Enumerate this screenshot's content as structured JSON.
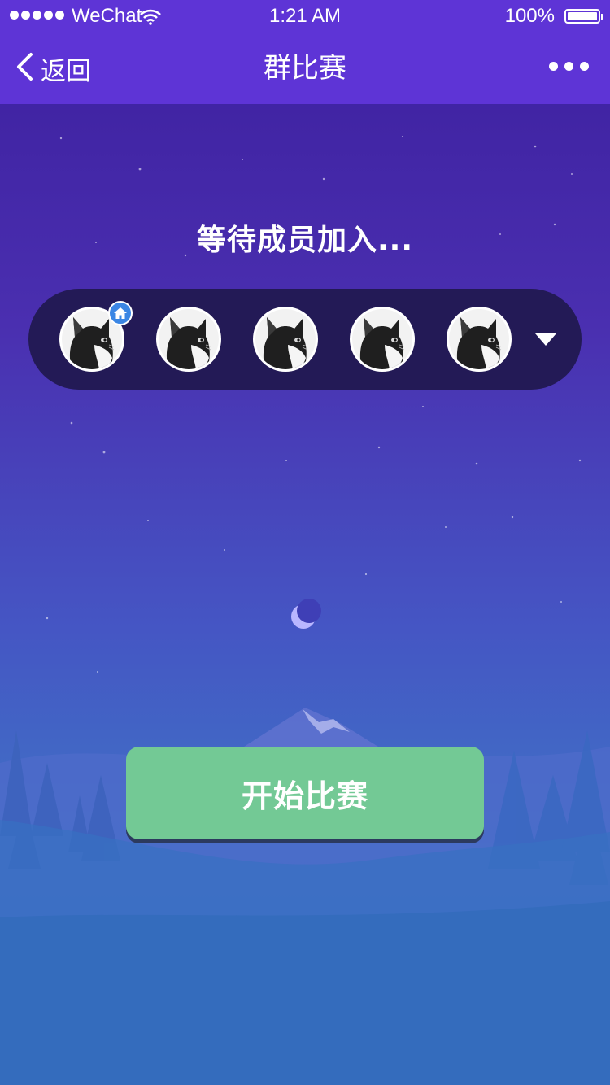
{
  "status_bar": {
    "carrier": "WeChat",
    "time": "1:21 AM",
    "battery": "100%"
  },
  "nav": {
    "back_label": "返回",
    "title": "群比赛"
  },
  "main": {
    "waiting_text": "等待成员加入...",
    "start_button": "开始比赛"
  },
  "members": [
    {
      "avatar": "cat-avatar",
      "is_host": true
    },
    {
      "avatar": "cat-avatar",
      "is_host": false
    },
    {
      "avatar": "cat-avatar",
      "is_host": false
    },
    {
      "avatar": "cat-avatar",
      "is_host": false
    },
    {
      "avatar": "cat-avatar",
      "is_host": false
    }
  ],
  "colors": {
    "nav_background": "#5e34d6",
    "members_bar": "#231a56",
    "start_button": "#73c995",
    "host_badge": "#3b86e4"
  }
}
